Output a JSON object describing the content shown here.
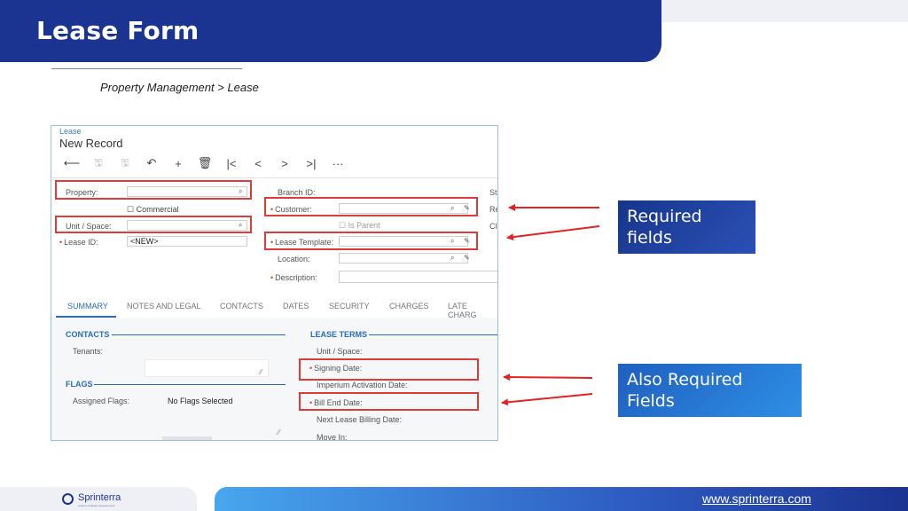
{
  "slide": {
    "title": "Lease Form",
    "breadcrumb": "Property Management > Lease",
    "callouts": {
      "required": "Required fields",
      "also_required": "Also Required Fields"
    },
    "footer": {
      "logo_text": "Sprinterra",
      "logo_sub": "Custom Software Development",
      "url": "www.sprinterra.com"
    }
  },
  "screen": {
    "crumb": "Lease",
    "record_title": "New Record",
    "toolbar": {
      "back": "⟵",
      "save": "🖫",
      "save_close": "🖫",
      "undo": "↶",
      "add": "+",
      "delete": "🗑",
      "first": "|<",
      "prev": "<",
      "next": ">",
      "last": ">|",
      "more": "···"
    },
    "form": {
      "property_label": "Property:",
      "commercial_label": "Commercial",
      "unit_space_label": "Unit / Space:",
      "lease_id_label": "Lease ID:",
      "lease_id_value": "<NEW>",
      "branch_id_label": "Branch ID:",
      "customer_label": "Customer:",
      "is_parent_label": "Is Parent",
      "lease_template_label": "Lease Template:",
      "location_label": "Location:",
      "description_label": "Description:",
      "cut_st": "St",
      "cut_re": "Re",
      "cut_cl": "Cl"
    },
    "tabs": [
      "SUMMARY",
      "NOTES AND LEGAL",
      "CONTACTS",
      "DATES",
      "SECURITY",
      "CHARGES",
      "LATE CHARG"
    ],
    "summary": {
      "contacts_header": "CONTACTS",
      "tenants_label": "Tenants:",
      "flags_header": "FLAGS",
      "assigned_flags_label": "Assigned Flags:",
      "assigned_flags_value": "No Flags Selected",
      "lease_terms_header": "LEASE TERMS",
      "unit_space_label": "Unit / Space:",
      "signing_date_label": "Signing Date:",
      "imperium_label": "Imperium Activation Date:",
      "bill_end_label": "Bill End Date:",
      "next_billing_label": "Next Lease Billing Date:",
      "move_in_label": "Move In:"
    }
  },
  "colors": {
    "header": "#1b3391",
    "accent": "#2a6cb8",
    "highlight": "#e03b3b",
    "required_star": "#d43"
  }
}
